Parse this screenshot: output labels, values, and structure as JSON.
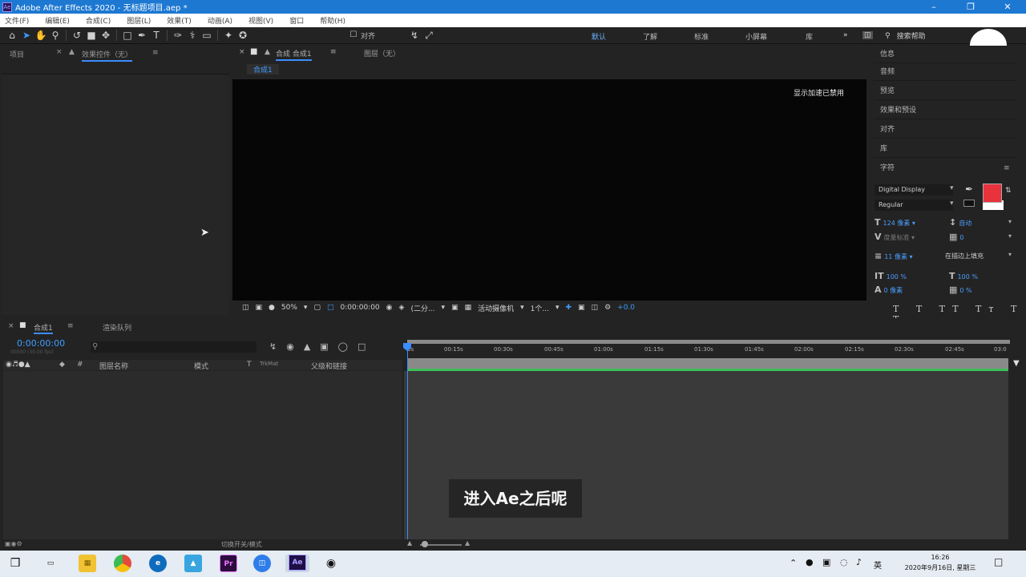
{
  "window": {
    "title": "Adobe After Effects 2020 - 无标题项目.aep *",
    "app_icon": "Ae"
  },
  "menu": [
    "文件(F)",
    "编辑(E)",
    "合成(C)",
    "图层(L)",
    "效果(T)",
    "动画(A)",
    "视图(V)",
    "窗口",
    "帮助(H)"
  ],
  "toolbar": {
    "snap_label": "对齐",
    "workspaces": [
      "默认",
      "了解",
      "标准",
      "小屏幕",
      "库"
    ],
    "active_workspace": "默认",
    "search_placeholder": "搜索帮助"
  },
  "left_panel": {
    "tab_project": "项目",
    "tab_effects": "效果控件（无）"
  },
  "viewer": {
    "tab_comp": "合成 合成1",
    "tab_layer": "图层（无）",
    "breadcrumb": "合成1",
    "gpu_warning": "显示加速已禁用",
    "zoom": "50%",
    "timecode": "0:00:00:00",
    "resolution": "(二分...",
    "camera": "活动摄像机",
    "views": "1个...",
    "exposure": "+0.0"
  },
  "right_panel": {
    "items": [
      "信息",
      "音频",
      "预览",
      "效果和预设",
      "对齐",
      "库",
      "字符"
    ],
    "character": {
      "font": "Digital Display",
      "style": "Regular",
      "size": "124 像素",
      "leading": "自动",
      "kerning": "度量标准",
      "tracking": "0",
      "stroke_width": "11 像素",
      "stroke_type": "在描边上填充",
      "vert_scale": "100 %",
      "horiz_scale": "100 %",
      "baseline": "0 像素",
      "tsume": "0 %",
      "fill_color": "#e8323c"
    }
  },
  "timeline": {
    "tab_comp": "合成1",
    "tab_render": "渲染队列",
    "timecode": "0:00:00:00",
    "timecode_sub": "00000 (30.00 fps)",
    "columns": [
      "图层名称",
      "模式",
      "T",
      "TrkMat",
      "父级和链接"
    ],
    "ticks": [
      "0s",
      "00:15s",
      "00:30s",
      "00:45s",
      "01:00s",
      "01:15s",
      "01:30s",
      "01:45s",
      "02:00s",
      "02:15s",
      "02:30s",
      "02:45s",
      "03:0"
    ],
    "bottom_label": "切换开关/模式"
  },
  "subtitle": "进入Ae之后呢",
  "taskbar": {
    "ime": "英",
    "time": "16:26",
    "date": "2020年9月16日, 星期三"
  }
}
